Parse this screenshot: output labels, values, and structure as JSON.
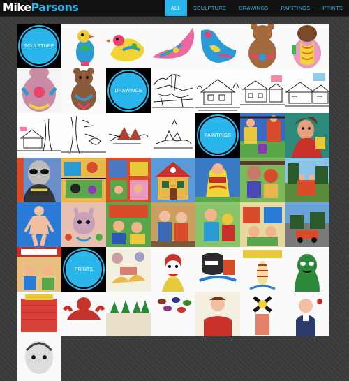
{
  "logo": {
    "first": "Mike",
    "last": "Parsons"
  },
  "nav": [
    {
      "label": "ALL",
      "active": true
    },
    {
      "label": "SCULPTURE",
      "active": false
    },
    {
      "label": "DRAWINGS",
      "active": false
    },
    {
      "label": "PAINTINGS",
      "active": false
    },
    {
      "label": "PRINTS",
      "active": false
    }
  ],
  "categories": {
    "sculpture": "SCULPTURE",
    "drawings": "DRAWINGS",
    "paintings": "PAINTINGS",
    "prints": "PRINTS"
  },
  "colors": {
    "accent": "#29b6ea",
    "bar": "#111111",
    "background": "#3a3a3a"
  }
}
